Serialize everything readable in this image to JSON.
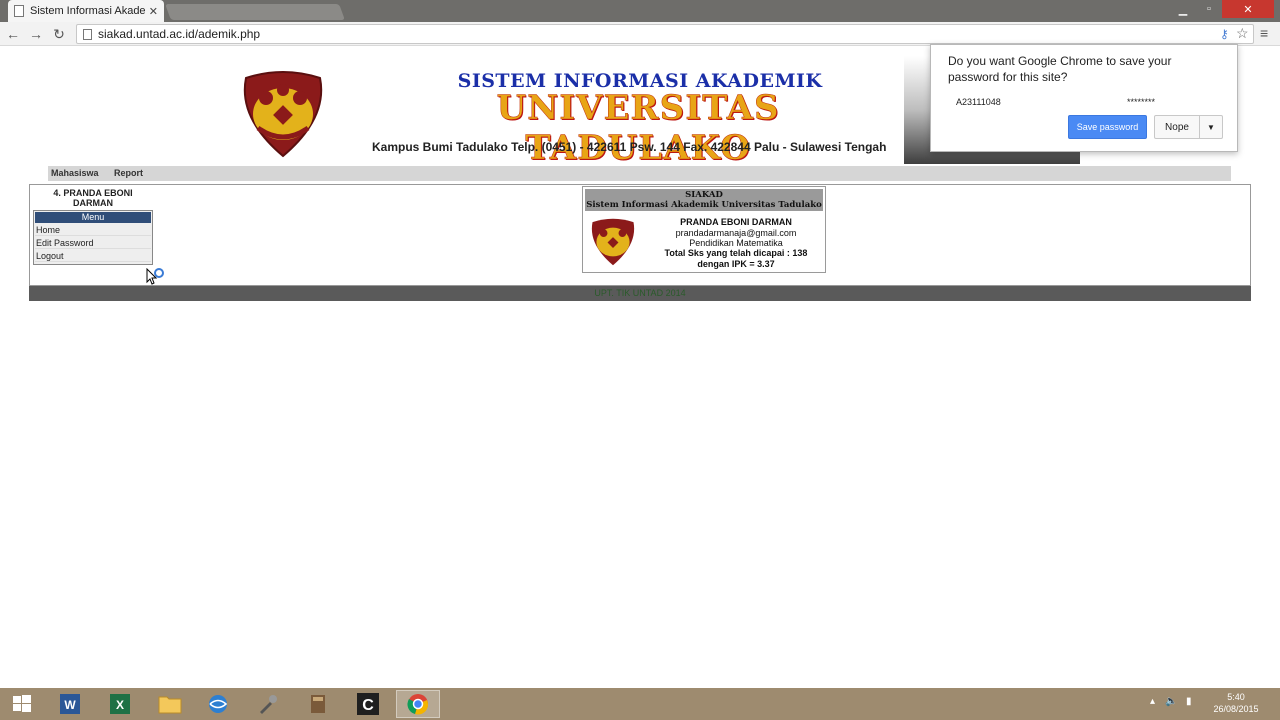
{
  "browser": {
    "tab_title": "Sistem Informasi Akadem",
    "url": "siakad.untad.ac.id/ademik.php"
  },
  "banner": {
    "subtitle": "SISTEM INFORMASI AKADEMIK",
    "title": "UNIVERSITAS TADULAKO",
    "address": "Kampus Bumi Tadulako Telp. (0451) - 422611 Psw. 144 Fax. 422844 Palu - Sulawesi Tengah"
  },
  "nav": {
    "items": [
      "Mahasiswa",
      "Report"
    ]
  },
  "sidebar": {
    "user_line1": "4. PRANDA EBONI",
    "user_line2": "DARMAN",
    "menu_title": "Menu",
    "links": [
      "Home",
      "Edit Password",
      "Logout"
    ]
  },
  "card": {
    "head_line1": "SIAKAD",
    "head_line2": "Sistem Informasi Akademik Universitas Tadulako",
    "name": "PRANDA EBONI DARMAN",
    "email": "prandadarmanaja@gmail.com",
    "program": "Pendidikan Matematika",
    "sks_line1": "Total Sks yang telah dicapai : 138",
    "sks_line2": "dengan IPK = 3.37"
  },
  "footer": {
    "text": "UPT. TIK UNTAD 2014"
  },
  "password_bubble": {
    "question": "Do you want Google Chrome to save your password for this site?",
    "username": "A23111048",
    "password_mask": "********",
    "save_label": "Save password",
    "nope_label": "Nope"
  },
  "taskbar": {
    "time": "5:40",
    "date": "26/08/2015"
  },
  "colors": {
    "accent_blue": "#1b2fa8",
    "title_orange": "#e8a516",
    "save_button": "#4a8af4",
    "taskbar": "#9e8b6f"
  }
}
